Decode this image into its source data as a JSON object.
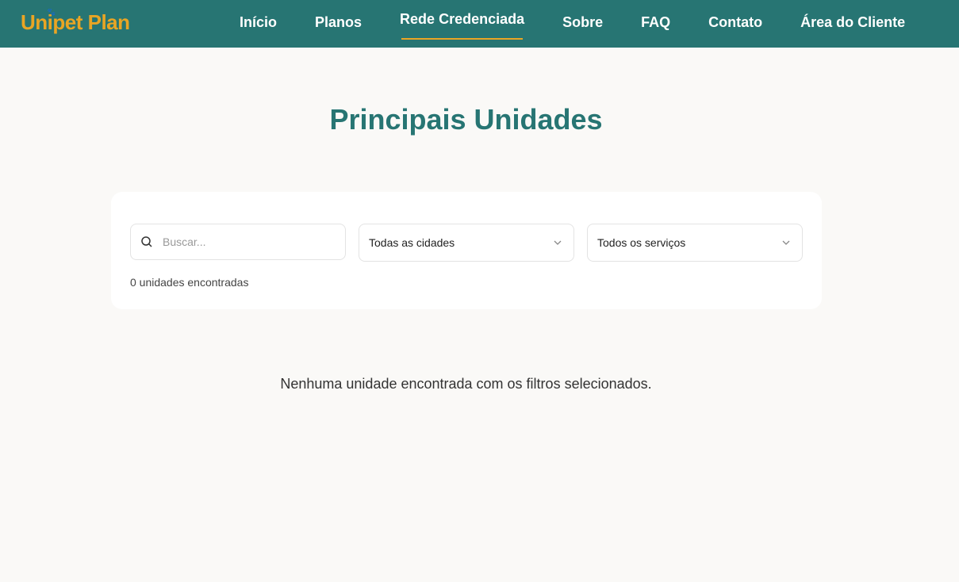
{
  "header": {
    "logo": "Unipet Plan",
    "nav": [
      "Início",
      "Planos",
      "Rede Credenciada",
      "Sobre",
      "FAQ",
      "Contato",
      "Área do Cliente"
    ]
  },
  "main": {
    "title": "Principais Unidades",
    "search": {
      "placeholder": "Buscar..."
    },
    "city_select": "Todas as cidades",
    "service_select": "Todos os serviços",
    "count": "0 unidades encontradas",
    "empty": "Nenhuma unidade encontrada com os filtros selecionados."
  },
  "colors": {
    "primary": "#277573",
    "accent": "#e9a524"
  }
}
